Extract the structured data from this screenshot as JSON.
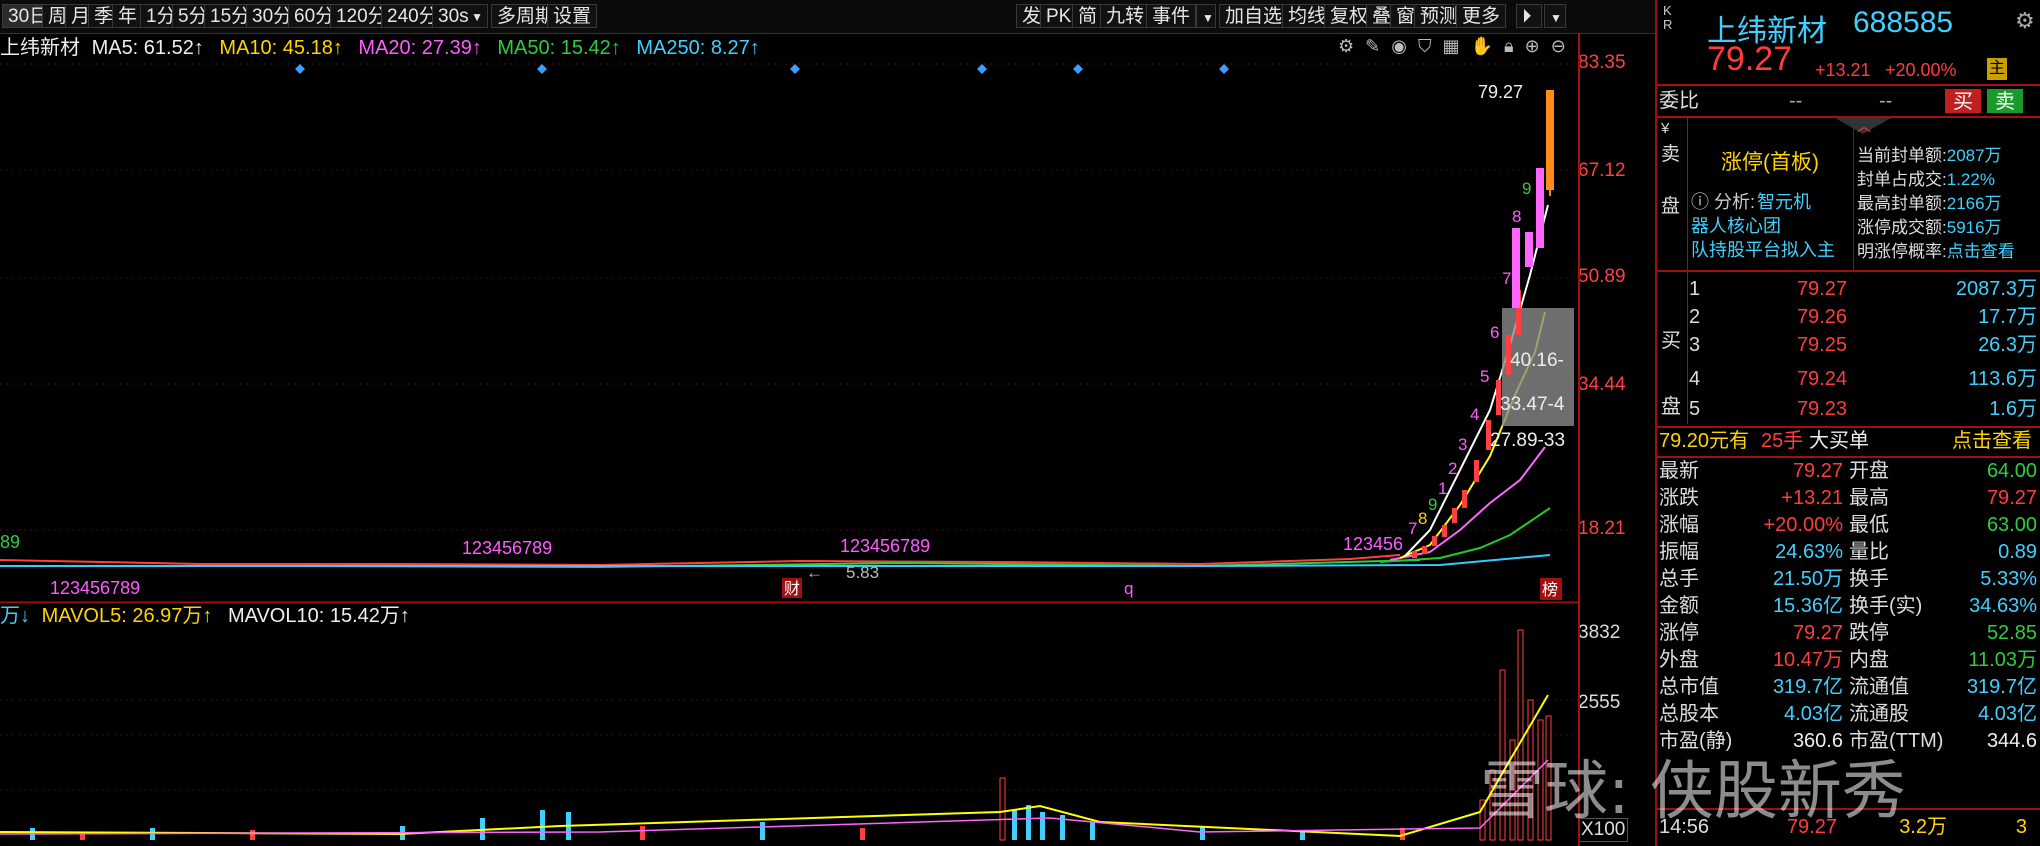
{
  "toolbar": {
    "periods": [
      "30日",
      "周",
      "月",
      "季",
      "年",
      "1分",
      "5分",
      "15分",
      "30分",
      "60分",
      "120分",
      "240分"
    ],
    "selected_period": "30s",
    "multi_period": "多周期",
    "settings": "设置",
    "right_items": [
      "发",
      "PK",
      "简",
      "九转",
      "事件",
      "加自选",
      "均线",
      "复权",
      "叠",
      "窗",
      "预测",
      "更多"
    ]
  },
  "indicator_line": {
    "stock_name": "上纬新材",
    "ma5": "MA5: 61.52↑",
    "ma10": "MA10: 45.18↑",
    "ma20": "MA20: 27.39↑",
    "ma50": "MA50: 15.42↑",
    "ma250": "MA250: 8.27↑"
  },
  "price_axis": [
    "83.35",
    "67.12",
    "50.89",
    "34.44",
    "18.21"
  ],
  "chart_annotations": {
    "high_label": "79.27",
    "range1": "40.16-",
    "range2": "33.47-4",
    "range3": "27.89-33",
    "low_label": "5.83",
    "seq1": "123456789",
    "seq2": "123456789",
    "seq3": "123456789",
    "seq4": "123456",
    "counts_up": [
      "7",
      "8",
      "9",
      "1",
      "2",
      "3",
      "4",
      "5",
      "6",
      "7",
      "8",
      "9"
    ],
    "marker_cai": "财",
    "marker_q": "q",
    "marker_bang": "榜"
  },
  "volume_bar": {
    "unit": "万↓",
    "mavol5": "MAVOL5: 26.97万↑",
    "mavol10": "MAVOL10: 15.42万↑",
    "axis": [
      "3832",
      "2555"
    ],
    "multiplier": "X100"
  },
  "quote": {
    "name": "上纬新材",
    "code": "688585",
    "price": "79.27",
    "change": "+13.21",
    "pct": "+20.00%",
    "badge": "主",
    "weibi_label": "委比",
    "weibi_val1": "--",
    "weibi_val2": "--",
    "buy_btn": "买",
    "sell_btn": "卖",
    "limit_title": "涨停(首板)",
    "analysis_label": "ⓘ 分析:",
    "analysis_text1": "智元机",
    "analysis_text2": "器人核心团",
    "analysis_text3": "队持股平台拟入主",
    "seal_rows": [
      {
        "k": "当前封单额:",
        "v": "2087万"
      },
      {
        "k": "封单占成交:",
        "v": "1.22%"
      },
      {
        "k": "最高封单额:",
        "v": "2166万"
      },
      {
        "k": "涨停成交额:",
        "v": "5916万"
      },
      {
        "k": "明涨停概率:",
        "v": "点击查看"
      }
    ],
    "sell_side_label": [
      "¥",
      "卖",
      "盘"
    ],
    "buy_side_label": [
      "买",
      "盘"
    ],
    "bids": [
      {
        "n": "1",
        "p": "79.27",
        "v": "2087.3万"
      },
      {
        "n": "2",
        "p": "79.26",
        "v": "17.7万"
      },
      {
        "n": "3",
        "p": "79.25",
        "v": "26.3万"
      },
      {
        "n": "4",
        "p": "79.24",
        "v": "113.6万"
      },
      {
        "n": "5",
        "p": "79.23",
        "v": "1.6万"
      }
    ],
    "bigorder": {
      "price": "79.20元有",
      "lots": "25手",
      "label": "大买单",
      "link": "点击查看"
    },
    "stats": [
      {
        "k1": "最新",
        "v1": "79.27",
        "c1": "red",
        "k2": "开盘",
        "v2": "64.00",
        "c2": "green"
      },
      {
        "k1": "涨跌",
        "v1": "+13.21",
        "c1": "red",
        "k2": "最高",
        "v2": "79.27",
        "c2": "red"
      },
      {
        "k1": "涨幅",
        "v1": "+20.00%",
        "c1": "red",
        "k2": "最低",
        "v2": "63.00",
        "c2": "green"
      },
      {
        "k1": "振幅",
        "v1": "24.63%",
        "c1": "cyan",
        "k2": "量比",
        "v2": "0.89",
        "c2": "cyan"
      },
      {
        "k1": "总手",
        "v1": "21.50万",
        "c1": "cyan",
        "k2": "换手",
        "v2": "5.33%",
        "c2": "cyan"
      },
      {
        "k1": "金额",
        "v1": "15.36亿",
        "c1": "cyan",
        "k2": "换手(实)",
        "v2": "34.63%",
        "c2": "cyan"
      },
      {
        "k1": "涨停",
        "v1": "79.27",
        "c1": "red",
        "k2": "跌停",
        "v2": "52.85",
        "c2": "green"
      },
      {
        "k1": "外盘",
        "v1": "10.47万",
        "c1": "red",
        "k2": "内盘",
        "v2": "11.03万",
        "c2": "green"
      },
      {
        "k1": "总市值",
        "v1": "319.7亿",
        "c1": "cyan",
        "k2": "流通值",
        "v2": "319.7亿",
        "c2": "cyan"
      },
      {
        "k1": "总股本",
        "v1": "4.03亿",
        "c1": "cyan",
        "k2": "流通股",
        "v2": "4.03亿",
        "c2": "cyan"
      },
      {
        "k1": "市盈(静)",
        "v1": "360.6",
        "c1": "white",
        "k2": "市盈(TTM)",
        "v2": "344.6",
        "c2": "white"
      }
    ],
    "tick": {
      "time": "14:56",
      "price": "79.27",
      "vol": "3.2万",
      "n": "3"
    }
  },
  "watermark": "雪球: 侠股新秀",
  "colors": {
    "up": "#ff3c3c",
    "down": "#2ecc40",
    "ma5": "#ffffff",
    "ma10": "#ffff00",
    "ma20": "#ff66ff",
    "ma50": "#22cc22",
    "ma250": "#33ccff"
  }
}
